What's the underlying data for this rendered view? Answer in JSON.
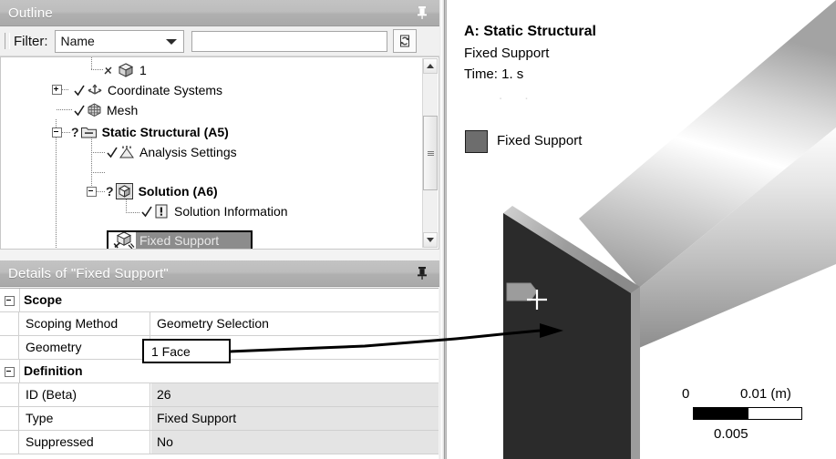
{
  "outline_panel": {
    "title": "Outline",
    "pin_icon": "pin-icon",
    "filter": {
      "label": "Filter:",
      "combo_value": "Name",
      "combo_arrow_icon": "chevron-down-icon",
      "text_value": "",
      "text_placeholder": "",
      "refresh_icon": "refresh-icon"
    },
    "tree_items": [
      {
        "label": "1",
        "bold": false,
        "icon": "body-cube-icon",
        "status": "suppressed-x",
        "expander": "none"
      },
      {
        "label": "Coordinate Systems",
        "bold": false,
        "icon": "coordinate-axes-icon",
        "status": "check",
        "expander": "plus"
      },
      {
        "label": "Mesh",
        "bold": false,
        "icon": "mesh-icon",
        "status": "check",
        "expander": "none"
      },
      {
        "label": "Static Structural (A5)",
        "bold": true,
        "icon": "folder-icon",
        "status": "question",
        "expander": "minus"
      },
      {
        "label": "Analysis Settings",
        "bold": false,
        "icon": "analysis-settings-icon",
        "status": "check",
        "expander": "none"
      },
      {
        "label": "Fixed Support",
        "bold": false,
        "icon": "fixed-support-icon",
        "status": "check",
        "expander": "none",
        "selected": true
      },
      {
        "label": "Solution (A6)",
        "bold": true,
        "icon": "solution-cube-icon",
        "status": "question",
        "expander": "minus"
      },
      {
        "label": "Solution Information",
        "bold": false,
        "icon": "solution-info-icon",
        "status": "check",
        "expander": "none"
      }
    ],
    "scrollbar": {
      "up_icon": "scroll-up-arrow-icon",
      "down_icon": "scroll-down-arrow-icon",
      "thumb_grip_icon": "scrollbar-grip-icon"
    }
  },
  "details_panel": {
    "title": "Details of \"Fixed Support\"",
    "pin_icon": "pin-icon",
    "rows": [
      {
        "kind": "group",
        "key": "Scope",
        "value": ""
      },
      {
        "kind": "field",
        "key": "Scoping Method",
        "value": "Geometry Selection",
        "value_bg": "white"
      },
      {
        "kind": "field",
        "key": "Geometry",
        "value": "1 Face",
        "value_bg": "white",
        "highlighted": true
      },
      {
        "kind": "group",
        "key": "Definition",
        "value": ""
      },
      {
        "kind": "field",
        "key": "ID (Beta)",
        "value": "26",
        "value_bg": "gray"
      },
      {
        "kind": "field",
        "key": "Type",
        "value": "Fixed Support",
        "value_bg": "gray"
      },
      {
        "kind": "field",
        "key": "Suppressed",
        "value": "No",
        "value_bg": "gray"
      }
    ]
  },
  "viewport": {
    "title": "A: Static Structural",
    "subtitle": "Fixed Support",
    "time": "Time: 1. s",
    "faint_line": ". .",
    "legend": {
      "label": "Fixed Support",
      "color": "#6d6d6d"
    },
    "annotation_arrow_icon": "annotation-arrow-icon",
    "probe_icon": "crosshair-icon",
    "scale_bar": {
      "min": "0",
      "mid": "0.005",
      "max": "0.01 (m)"
    }
  },
  "colors": {
    "titlebar": "#b0b0b0",
    "selection_highlight": "#8c8c8c",
    "value_gray": "#e4e4e4",
    "face_dark": "#2b2b2b",
    "beam_light": "#f2f2f2"
  }
}
